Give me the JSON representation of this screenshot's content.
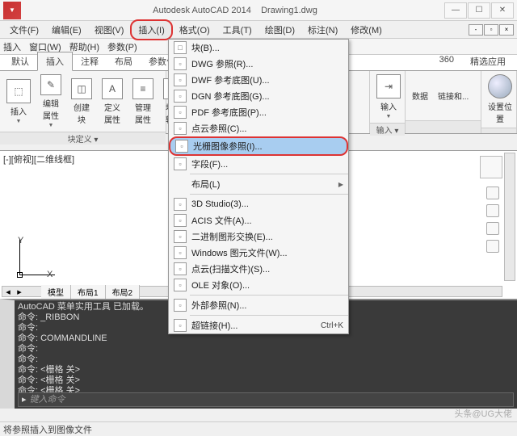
{
  "title": {
    "app": "Autodesk AutoCAD 2014",
    "doc": "Drawing1.dwg"
  },
  "menubar": [
    "文件(F)",
    "编辑(E)",
    "视图(V)",
    "插入(I)",
    "格式(O)",
    "工具(T)",
    "绘图(D)",
    "标注(N)",
    "修改(M)"
  ],
  "menubar_active_index": 3,
  "toolbar2": [
    "插入",
    "窗口(W)",
    "帮助(H)",
    "参数(P)"
  ],
  "ribbon_tabs_left": [
    "默认",
    "插入",
    "注释",
    "布局",
    "参数化"
  ],
  "ribbon_tabs_right": [
    "360",
    "精选应用"
  ],
  "ribbon_tabs_active_index": 1,
  "ribbon": {
    "panel1": {
      "buttons": [
        "插入",
        "编辑属性",
        "创建块",
        "定义属性",
        "管理属性",
        "块编辑器"
      ],
      "title": "块定义 ▾"
    },
    "panel2": {
      "buttons": [
        "输入"
      ],
      "title": "输入 ▾"
    },
    "panel3": {
      "buttons": [
        "数据",
        "链接和..."
      ],
      "title": ""
    },
    "panel4": {
      "buttons": [
        "设置位置"
      ],
      "title": ""
    }
  },
  "dropdown": [
    {
      "t": "item",
      "icon": "□",
      "text": "块(B)...",
      "arrow": false
    },
    {
      "t": "item",
      "icon": "▫",
      "text": "DWG 参照(R)...",
      "arrow": false
    },
    {
      "t": "item",
      "icon": "▫",
      "text": "DWF 参考底图(U)...",
      "arrow": false
    },
    {
      "t": "item",
      "icon": "▫",
      "text": "DGN 参考底图(G)...",
      "arrow": false
    },
    {
      "t": "item",
      "icon": "▫",
      "text": "PDF 参考底图(P)...",
      "arrow": false
    },
    {
      "t": "item",
      "icon": "▫",
      "text": "点云参照(C)...",
      "arrow": false
    },
    {
      "t": "item",
      "icon": "▫",
      "text": "光栅图像参照(I)...",
      "arrow": false,
      "hl": true
    },
    {
      "t": "item",
      "icon": "▫",
      "text": "字段(F)...",
      "arrow": false
    },
    {
      "t": "sep"
    },
    {
      "t": "item",
      "icon": "",
      "text": "布局(L)",
      "arrow": true
    },
    {
      "t": "sep"
    },
    {
      "t": "item",
      "icon": "▫",
      "text": "3D Studio(3)...",
      "arrow": false
    },
    {
      "t": "item",
      "icon": "▫",
      "text": "ACIS 文件(A)...",
      "arrow": false
    },
    {
      "t": "item",
      "icon": "▫",
      "text": "二进制图形交换(E)...",
      "arrow": false
    },
    {
      "t": "item",
      "icon": "▫",
      "text": "Windows 图元文件(W)...",
      "arrow": false
    },
    {
      "t": "item",
      "icon": "▫",
      "text": "点云(扫描文件)(S)...",
      "arrow": false
    },
    {
      "t": "item",
      "icon": "▫",
      "text": "OLE 对象(O)...",
      "arrow": false
    },
    {
      "t": "sep"
    },
    {
      "t": "item",
      "icon": "▫",
      "text": "外部参照(N)...",
      "arrow": false
    },
    {
      "t": "sep"
    },
    {
      "t": "item",
      "icon": "▫",
      "text": "超链接(H)...",
      "arrow": false,
      "shortcut": "Ctrl+K"
    }
  ],
  "canvas": {
    "corner": "[-][俯视][二维线框]",
    "ucs_x": "X",
    "ucs_y": "Y"
  },
  "model_tabs": [
    "模型",
    "布局1",
    "布局2"
  ],
  "cmd": {
    "lines": [
      "AutoCAD 菜单实用工具 已加载。",
      "命令: _RIBBON",
      "命令:",
      "命令: COMMANDLINE",
      "命令:",
      "命令:",
      "命令: <栅格 关>",
      "命令: <栅格 关>",
      "命令: <栅格 关>"
    ],
    "prompt_icon": "▸",
    "prompt_placeholder": "键入命令"
  },
  "status": "将参照插入到图像文件",
  "watermark": "头条@UG大佬"
}
